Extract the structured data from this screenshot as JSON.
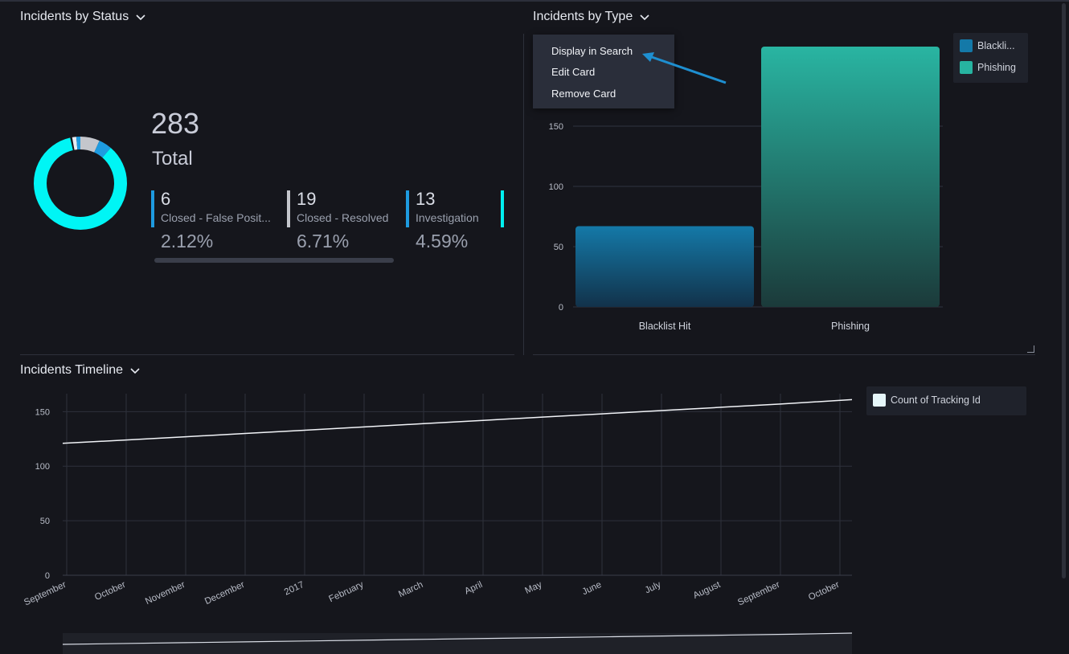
{
  "status_card": {
    "title": "Incidents by Status",
    "total_value": "283",
    "total_label": "Total",
    "stats": [
      {
        "count": "6",
        "label": "Closed - False Posit...",
        "pct": "2.12%",
        "color": "#1e9be0"
      },
      {
        "count": "19",
        "label": "Closed - Resolved",
        "pct": "6.71%",
        "color": "#c4c6cc"
      },
      {
        "count": "13",
        "label": "Investigation",
        "pct": "4.59%",
        "color": "#1e9be0"
      }
    ],
    "extra_bar_color": "#00f0f0",
    "donut_colors": {
      "main": "#00f5f5",
      "resolved": "#c4c6cc",
      "investigation": "#1e9be0",
      "fp": "#1e9be0",
      "white": "#e8ecf2"
    }
  },
  "type_card": {
    "title": "Incidents by Type",
    "menu": {
      "display_in_search": "Display in Search",
      "edit_card": "Edit Card",
      "remove_card": "Remove Card"
    },
    "legend": [
      {
        "label": "Blackli...",
        "color": "#1479a8"
      },
      {
        "label": "Phishing",
        "color": "#27b3a0"
      }
    ]
  },
  "timeline_card": {
    "title": "Incidents Timeline",
    "legend_label": "Count of Tracking Id",
    "legend_color": "#e6f7fa"
  },
  "chart_data": [
    {
      "type": "bar",
      "categories": [
        "Blacklist Hit",
        "Phishing"
      ],
      "values": [
        67,
        216
      ],
      "yticks": [
        0,
        50,
        100,
        150
      ],
      "ylim": [
        0,
        220
      ]
    },
    {
      "type": "line",
      "x": [
        "September",
        "October",
        "November",
        "December",
        "2017",
        "February",
        "March",
        "April",
        "May",
        "June",
        "July",
        "August",
        "September",
        "October"
      ],
      "series": [
        {
          "name": "Count of Tracking Id",
          "values": [
            121,
            124,
            127,
            130,
            133,
            136,
            139,
            142,
            145,
            148,
            151,
            154,
            157,
            161
          ]
        }
      ],
      "yticks": [
        0,
        50,
        100,
        150
      ],
      "ylim": [
        0,
        165
      ]
    }
  ]
}
